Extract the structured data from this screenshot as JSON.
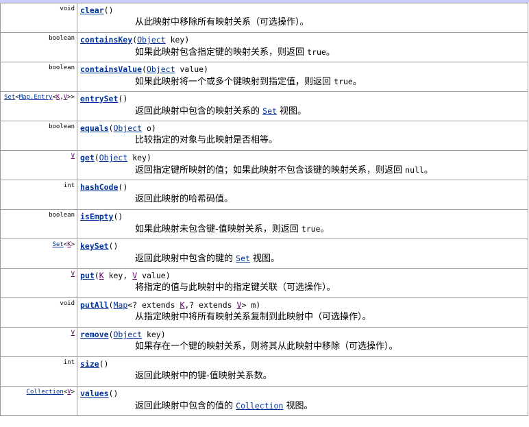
{
  "methods": [
    {
      "type": [
        {
          "t": "void"
        }
      ],
      "name": "clear",
      "params": [],
      "desc": [
        {
          "t": "从此映射中移除所有映射关系（可选操作）。"
        }
      ]
    },
    {
      "type": [
        {
          "t": "boolean"
        }
      ],
      "name": "containsKey",
      "params": [
        {
          "t": "Object",
          "k": "link"
        },
        {
          "t": " key"
        }
      ],
      "desc": [
        {
          "t": "如果此映射包含指定键的映射关系，则返回 "
        },
        {
          "t": "true",
          "k": "code"
        },
        {
          "t": "。"
        }
      ]
    },
    {
      "type": [
        {
          "t": "boolean"
        }
      ],
      "name": "containsValue",
      "params": [
        {
          "t": "Object",
          "k": "link"
        },
        {
          "t": " value"
        }
      ],
      "desc": [
        {
          "t": "如果此映射将一个或多个键映射到指定值，则返回 "
        },
        {
          "t": "true",
          "k": "code"
        },
        {
          "t": "。"
        }
      ]
    },
    {
      "type": [
        {
          "t": "Set",
          "k": "link"
        },
        {
          "t": "<"
        },
        {
          "t": "Map.Entry",
          "k": "link"
        },
        {
          "t": "<"
        },
        {
          "t": "K",
          "k": "var"
        },
        {
          "t": ","
        },
        {
          "t": "V",
          "k": "var"
        },
        {
          "t": ">>"
        }
      ],
      "name": "entrySet",
      "params": [],
      "desc": [
        {
          "t": "返回此映射中包含的映射关系的 "
        },
        {
          "t": "Set",
          "k": "codelink"
        },
        {
          "t": " 视图。"
        }
      ]
    },
    {
      "type": [
        {
          "t": "boolean"
        }
      ],
      "name": "equals",
      "params": [
        {
          "t": "Object",
          "k": "link"
        },
        {
          "t": " o"
        }
      ],
      "desc": [
        {
          "t": "比较指定的对象与此映射是否相等。"
        }
      ]
    },
    {
      "type": [
        {
          "t": "V",
          "k": "var"
        }
      ],
      "name": "get",
      "params": [
        {
          "t": "Object",
          "k": "link"
        },
        {
          "t": " key"
        }
      ],
      "desc": [
        {
          "t": "返回指定键所映射的值；如果此映射不包含该键的映射关系，则返回 "
        },
        {
          "t": "null",
          "k": "code"
        },
        {
          "t": "。"
        }
      ]
    },
    {
      "type": [
        {
          "t": "int"
        }
      ],
      "name": "hashCode",
      "params": [],
      "desc": [
        {
          "t": "返回此映射的哈希码值。"
        }
      ]
    },
    {
      "type": [
        {
          "t": "boolean"
        }
      ],
      "name": "isEmpty",
      "params": [],
      "desc": [
        {
          "t": "如果此映射未包含键-值映射关系，则返回 "
        },
        {
          "t": "true",
          "k": "code"
        },
        {
          "t": "。"
        }
      ]
    },
    {
      "type": [
        {
          "t": "Set",
          "k": "link"
        },
        {
          "t": "<"
        },
        {
          "t": "K",
          "k": "var"
        },
        {
          "t": ">"
        }
      ],
      "name": "keySet",
      "params": [],
      "desc": [
        {
          "t": "返回此映射中包含的键的 "
        },
        {
          "t": "Set",
          "k": "codelink"
        },
        {
          "t": " 视图。"
        }
      ]
    },
    {
      "type": [
        {
          "t": "V",
          "k": "var"
        }
      ],
      "name": "put",
      "params": [
        {
          "t": "K",
          "k": "var"
        },
        {
          "t": " key, "
        },
        {
          "t": "V",
          "k": "var"
        },
        {
          "t": " value"
        }
      ],
      "desc": [
        {
          "t": "将指定的值与此映射中的指定键关联（可选操作）。"
        }
      ]
    },
    {
      "type": [
        {
          "t": "void"
        }
      ],
      "name": "putAll",
      "params": [
        {
          "t": "Map",
          "k": "link"
        },
        {
          "t": "<? extends "
        },
        {
          "t": "K",
          "k": "var"
        },
        {
          "t": ",? extends "
        },
        {
          "t": "V",
          "k": "var"
        },
        {
          "t": "> m"
        }
      ],
      "desc": [
        {
          "t": "从指定映射中将所有映射关系复制到此映射中（可选操作）。"
        }
      ]
    },
    {
      "type": [
        {
          "t": "V",
          "k": "var"
        }
      ],
      "name": "remove",
      "params": [
        {
          "t": "Object",
          "k": "link"
        },
        {
          "t": " key"
        }
      ],
      "desc": [
        {
          "t": "如果存在一个键的映射关系，则将其从此映射中移除（可选操作）。"
        }
      ]
    },
    {
      "type": [
        {
          "t": "int"
        }
      ],
      "name": "size",
      "params": [],
      "desc": [
        {
          "t": "返回此映射中的键-值映射关系数。"
        }
      ]
    },
    {
      "type": [
        {
          "t": "Collection",
          "k": "link"
        },
        {
          "t": "<"
        },
        {
          "t": "V",
          "k": "var"
        },
        {
          "t": ">"
        }
      ],
      "name": "values",
      "params": [],
      "desc": [
        {
          "t": "返回此映射中包含的值的 "
        },
        {
          "t": "Collection",
          "k": "codelink"
        },
        {
          "t": " 视图。"
        }
      ]
    }
  ]
}
